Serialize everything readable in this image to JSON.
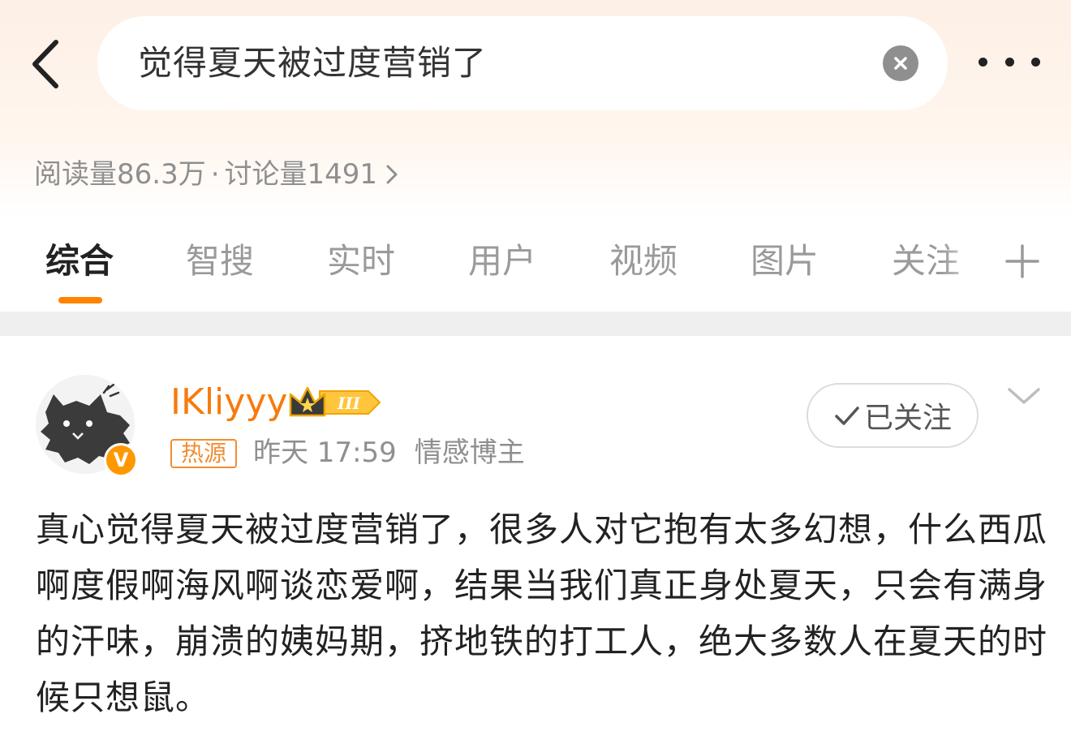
{
  "search": {
    "query": "觉得夏天被过度营销了"
  },
  "stats": {
    "reads": "阅读量86.3万",
    "separator": "·",
    "discussions": "讨论量1491"
  },
  "tabs": [
    {
      "label": "综合",
      "active": true
    },
    {
      "label": "智搜"
    },
    {
      "label": "实时"
    },
    {
      "label": "用户"
    },
    {
      "label": "视频"
    },
    {
      "label": "图片"
    },
    {
      "label": "关注"
    }
  ],
  "post": {
    "username": "IKliyyy",
    "level_badge": "III",
    "tag": "热源",
    "time": "昨天 17:59",
    "category": "情感博主",
    "follow_label": "已关注",
    "verified_badge": "V",
    "text": "真心觉得夏天被过度营销了，很多人对它抱有太多幻想，什么西瓜啊度假啊海风啊谈恋爱啊，结果当我们真正身处夏天，只会有满身的汗味，崩溃的姨妈期，挤地铁的打工人，绝大多数人在夏天的时候只想鼠。"
  },
  "colors": {
    "accent": "#ff8200",
    "username": "#f77b0c",
    "muted": "#8f8f8f",
    "header_bg": "#fdf0e6"
  },
  "icons": [
    "back-arrow-icon",
    "clear-icon",
    "more-icon",
    "chevron-right-icon",
    "add-icon",
    "crown-icon",
    "checkmark-icon",
    "chevron-down-icon"
  ]
}
